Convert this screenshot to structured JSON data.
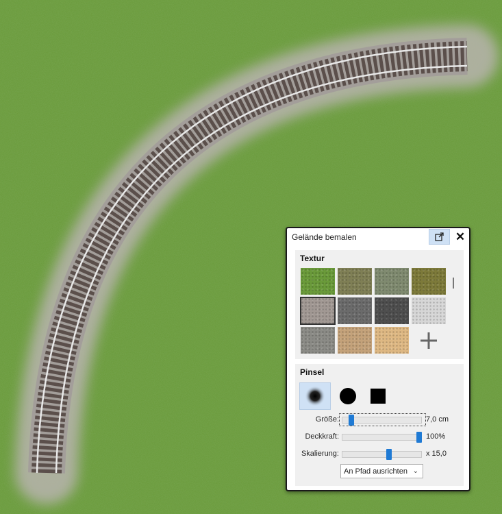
{
  "panel": {
    "title": "Gelände bemalen",
    "popout_icon": "popout-icon",
    "close_label": "✕"
  },
  "texture": {
    "heading": "Textur",
    "swatches": [
      {
        "name": "grass",
        "color": "#6a9a3a"
      },
      {
        "name": "rough-grass",
        "color": "#7f7f55"
      },
      {
        "name": "moss-rock",
        "color": "#7f8a6f"
      },
      {
        "name": "olive-field",
        "color": "#7d7a3a"
      },
      {
        "name": "gravel",
        "color": "#a19893"
      },
      {
        "name": "cobblestone",
        "color": "#6b6b6b"
      },
      {
        "name": "dark-stone",
        "color": "#4e4e4e"
      },
      {
        "name": "light-stone",
        "color": "#d6d6d6"
      },
      {
        "name": "concrete",
        "color": "#8b8b86"
      },
      {
        "name": "sand",
        "color": "#c4a27a"
      },
      {
        "name": "wood",
        "color": "#deb883"
      }
    ],
    "selected_index": 4,
    "add_icon": "plus-icon"
  },
  "brush": {
    "heading": "Pinsel",
    "shapes": [
      "soft-brush-icon",
      "circle-brush-icon",
      "square-brush-icon"
    ],
    "selected_shape": 0,
    "sliders": [
      {
        "label": "Größe:",
        "value_text": "7,0 cm",
        "position": 0.09
      },
      {
        "label": "Deckkraft:",
        "value_text": "100%",
        "position": 1.0
      },
      {
        "label": "Skalierung:",
        "value_text": "x 15,0",
        "position": 0.6
      }
    ],
    "align_select": "An Pfad ausrichten"
  },
  "colors": {
    "accent": "#1f7ad4",
    "grass": "#6a9a3a",
    "ballast": "#a39e9a",
    "rail": "#e8e8e8"
  }
}
